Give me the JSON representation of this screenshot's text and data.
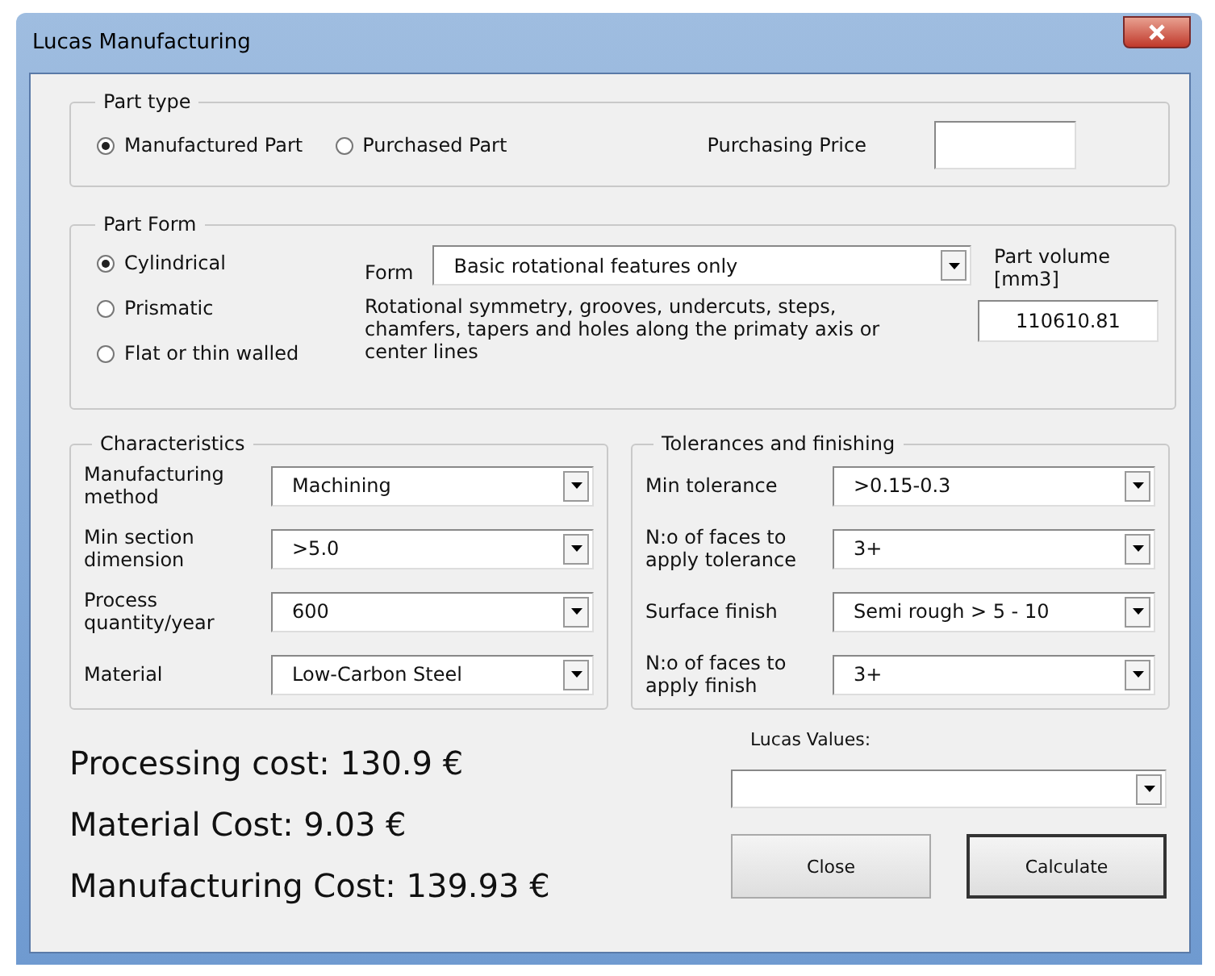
{
  "window": {
    "title": "Lucas Manufacturing"
  },
  "part_type": {
    "title": "Part type",
    "options": [
      {
        "label": "Manufactured Part",
        "selected": true
      },
      {
        "label": "Purchased Part",
        "selected": false
      }
    ],
    "price_label": "Purchasing Price"
  },
  "part_form": {
    "title": "Part Form",
    "options": [
      {
        "label": "Cylindrical",
        "selected": true
      },
      {
        "label": "Prismatic",
        "selected": false
      },
      {
        "label": "Flat or thin walled",
        "selected": false
      }
    ],
    "form_label": "Form",
    "form_value": "Basic rotational features only",
    "description": "Rotational symmetry, grooves, undercuts, steps, chamfers, tapers and holes along the primaty axis or center lines",
    "volume_label": "Part volume [mm3]",
    "volume_value": "110610.81"
  },
  "characteristics": {
    "title": "Characteristics",
    "fields": [
      {
        "label": "Manufacturing method",
        "value": "Machining"
      },
      {
        "label": "Min section dimension",
        "value": ">5.0"
      },
      {
        "label": "Process quantity/year",
        "value": "600"
      },
      {
        "label": "Material",
        "value": "Low-Carbon Steel"
      }
    ]
  },
  "tolerances": {
    "title": "Tolerances and finishing",
    "fields": [
      {
        "label": "Min tolerance",
        "value": ">0.15-0.3"
      },
      {
        "label": "N:o of faces to apply tolerance",
        "value": "3+"
      },
      {
        "label": "Surface finish",
        "value": "Semi rough > 5 - 10"
      },
      {
        "label": "N:o of faces to apply finish",
        "value": "3+"
      }
    ]
  },
  "costs": [
    "Processing cost: 130.9 €",
    "Material Cost: 9.03 €",
    "Manufacturing Cost: 139.93 €"
  ],
  "lucas_values": {
    "label": "Lucas Values:"
  },
  "buttons": [
    {
      "label": "Close",
      "default": false
    },
    {
      "label": "Calculate",
      "default": true
    }
  ]
}
